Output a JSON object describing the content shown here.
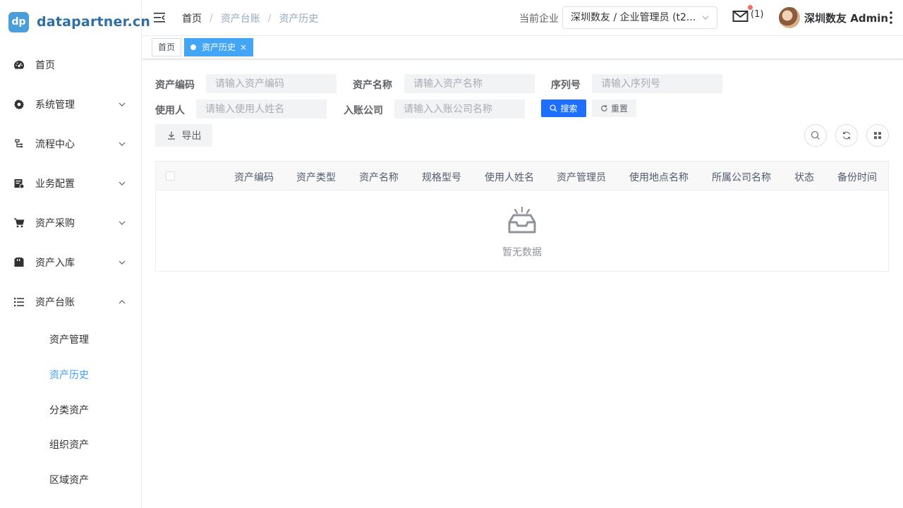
{
  "logo": {
    "badge": "dp",
    "text": "datapartner.cn"
  },
  "sidebar": {
    "items": [
      {
        "label": "首页",
        "icon": "dashboard-icon"
      },
      {
        "label": "系统管理",
        "icon": "gear-icon"
      },
      {
        "label": "流程中心",
        "icon": "flow-icon"
      },
      {
        "label": "业务配置",
        "icon": "config-icon"
      },
      {
        "label": "资产采购",
        "icon": "cart-icon"
      },
      {
        "label": "资产入库",
        "icon": "storage-icon"
      },
      {
        "label": "资产台账",
        "icon": "list-icon"
      }
    ],
    "subitems": [
      {
        "label": "资产管理"
      },
      {
        "label": "资产历史",
        "active": true
      },
      {
        "label": "分类资产"
      },
      {
        "label": "组织资产"
      },
      {
        "label": "区域资产"
      }
    ]
  },
  "header": {
    "breadcrumb": [
      "首页",
      "资产台账",
      "资产历史"
    ],
    "separator": "/",
    "enterprise_label": "当前企业",
    "enterprise_value": "深圳数友 / 企业管理员 (t2...",
    "mail_count": "(1)",
    "username": "深圳数友 Admin"
  },
  "tags": [
    {
      "label": "首页"
    },
    {
      "label": "资产历史",
      "active": true,
      "close": "×"
    }
  ],
  "search": {
    "fields": [
      {
        "label": "资产编码",
        "placeholder": "请输入资产编码"
      },
      {
        "label": "资产名称",
        "placeholder": "请输入资产名称"
      },
      {
        "label": "序列号",
        "placeholder": "请输入序列号"
      },
      {
        "label": "使用人",
        "placeholder": "请输入使用人姓名"
      },
      {
        "label": "入账公司",
        "placeholder": "请输入入账公司名称"
      }
    ],
    "search_label": "搜索",
    "reset_label": "重置"
  },
  "toolbar": {
    "export_label": "导出"
  },
  "table": {
    "columns": [
      "资产编码",
      "资产类型",
      "资产名称",
      "规格型号",
      "使用人姓名",
      "资产管理员",
      "使用地点名称",
      "所属公司名称",
      "状态",
      "备份时间"
    ],
    "empty_text": "暂无数据"
  },
  "colors": {
    "primary": "#1e6fff",
    "tag_active": "#42a5f5",
    "menu_active": "#409eff"
  }
}
